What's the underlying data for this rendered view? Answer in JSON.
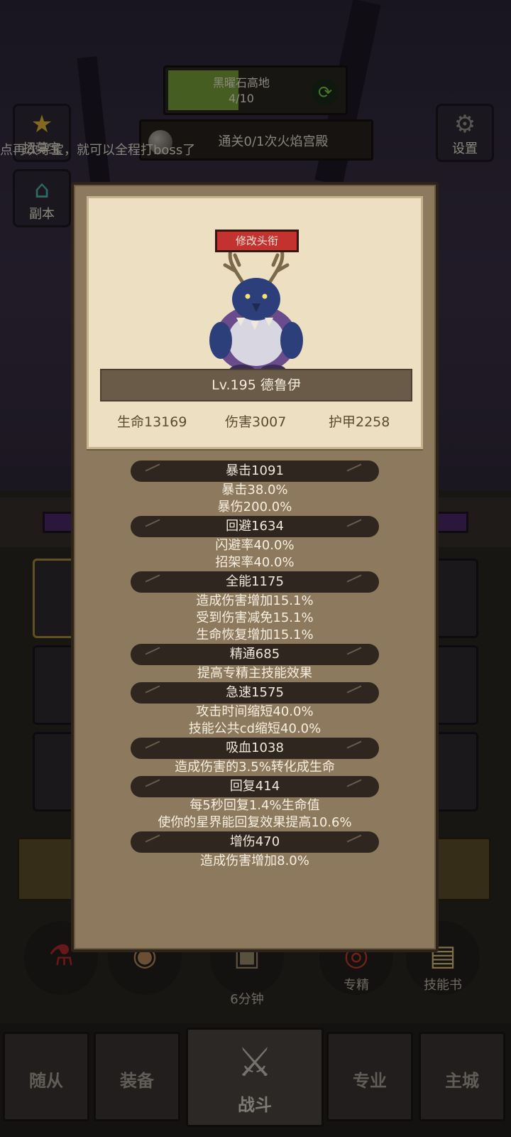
{
  "map": {
    "title": "黑曜石高地",
    "progress": "4/10",
    "progress_fraction": 0.4
  },
  "quest": {
    "text": "通关0/1次火焰宫殿"
  },
  "tip": "点再次寻宝，就可以全程打boss了",
  "side_buttons": {
    "treasure": "招募宝",
    "dungeon": "副本",
    "settings": "设置"
  },
  "bottom_row": {
    "timer": "6分钟",
    "specialty": "专精",
    "skill_book": "技能书"
  },
  "tabs": {
    "followers": "随从",
    "equipment": "装备",
    "battle": "战斗",
    "profession": "专业",
    "main_city": "主城"
  },
  "hero": {
    "rename_label": "修改头衔",
    "name": "Lv.195 德鲁伊",
    "hp": "生命13169",
    "damage": "伤害3007",
    "armor": "护甲2258"
  },
  "stats": [
    {
      "name": "暴击1091",
      "lines": [
        "暴击38.0%",
        "暴伤200.0%"
      ]
    },
    {
      "name": "回避1634",
      "lines": [
        "闪避率40.0%",
        "招架率40.0%"
      ]
    },
    {
      "name": "全能1175",
      "lines": [
        "造成伤害增加15.1%",
        "受到伤害减免15.1%",
        "生命恢复增加15.1%"
      ]
    },
    {
      "name": "精通685",
      "lines": [
        "提高专精主技能效果"
      ]
    },
    {
      "name": "急速1575",
      "lines": [
        "攻击时间缩短40.0%",
        "技能公共cd缩短40.0%"
      ]
    },
    {
      "name": "吸血1038",
      "lines": [
        "造成伤害的3.5%转化成生命"
      ]
    },
    {
      "name": "回复414",
      "lines": [
        "每5秒回复1.4%生命值",
        "使你的星界能回复效果提高10.6%"
      ]
    },
    {
      "name": "增伤470",
      "lines": [
        "造成伤害增加8.0%"
      ]
    }
  ],
  "colors": {
    "modal_bg": "#8d7a5e",
    "card_bg": "#ede0c2",
    "stat_header": "#2f2620",
    "rename_red": "#c3322e",
    "progress_green": "#79a13a"
  }
}
